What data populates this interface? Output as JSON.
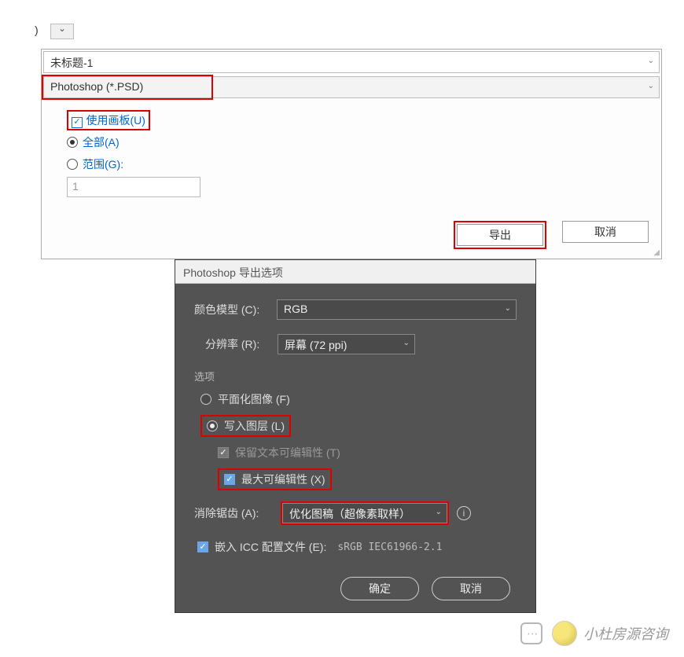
{
  "top": {
    "close_paren": ")"
  },
  "dialog1": {
    "filename": "未标题-1",
    "format": "Photoshop (*.PSD)",
    "use_artboard_label": "使用画板(U)",
    "all_label": "全部(A)",
    "range_label": "范围(G):",
    "range_value": "1",
    "export_btn": "导出",
    "cancel_btn": "取消"
  },
  "dialog2": {
    "title": "Photoshop 导出选项",
    "color_model_label": "颜色模型 (C):",
    "color_model_value": "RGB",
    "resolution_label": "分辨率 (R):",
    "resolution_value": "屏幕 (72 ppi)",
    "options_label": "选项",
    "flatten_label": "平面化图像 (F)",
    "write_layers_label": "写入图层 (L)",
    "preserve_text_label": "保留文本可编辑性 (T)",
    "max_edit_label": "最大可编辑性 (X)",
    "antialias_label": "消除锯齿 (A):",
    "antialias_value": "优化图稿（超像素取样）",
    "embed_icc_label": "嵌入 ICC 配置文件 (E):",
    "icc_profile": "sRGB IEC61966-2.1",
    "ok_btn": "确定",
    "cancel_btn": "取消"
  },
  "watermark": {
    "text": "小杜房源咨询"
  }
}
